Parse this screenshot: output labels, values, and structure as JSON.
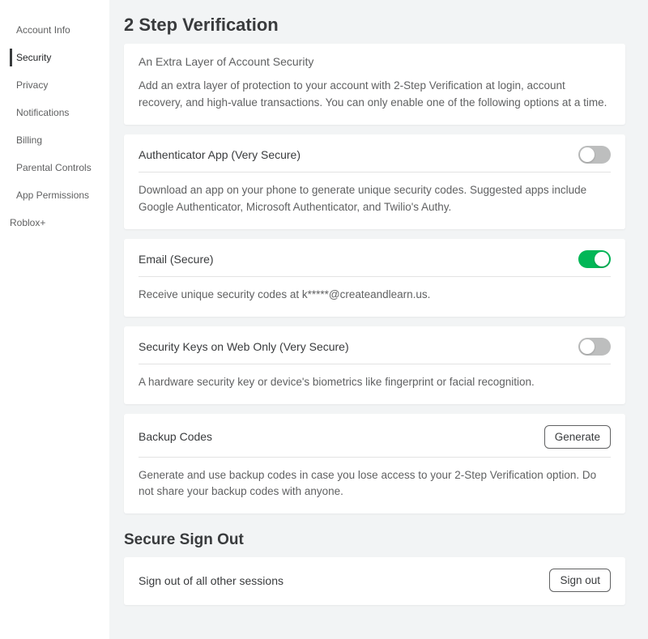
{
  "sidebar": {
    "items": [
      {
        "label": "Account Info",
        "active": false
      },
      {
        "label": "Security",
        "active": true
      },
      {
        "label": "Privacy",
        "active": false
      },
      {
        "label": "Notifications",
        "active": false
      },
      {
        "label": "Billing",
        "active": false
      },
      {
        "label": "Parental Controls",
        "active": false
      },
      {
        "label": "App Permissions",
        "active": false
      }
    ],
    "extra": {
      "label": "Roblox+"
    }
  },
  "twostep": {
    "heading": "2 Step Verification",
    "intro_title": "An Extra Layer of Account Security",
    "intro_desc": "Add an extra layer of protection to your account with 2-Step Verification at login, account recovery, and high-value transactions. You can only enable one of the following options at a time."
  },
  "auth_app": {
    "title": "Authenticator App (Very Secure)",
    "desc": "Download an app on your phone to generate unique security codes. Suggested apps include Google Authenticator, Microsoft Authenticator, and Twilio's Authy.",
    "enabled": false
  },
  "email": {
    "title": "Email (Secure)",
    "desc": "Receive unique security codes at k*****@createandlearn.us.",
    "enabled": true
  },
  "security_keys": {
    "title": "Security Keys on Web Only (Very Secure)",
    "desc": "A hardware security key or device's biometrics like fingerprint or facial recognition.",
    "enabled": false
  },
  "backup": {
    "title": "Backup Codes",
    "button": "Generate",
    "desc": "Generate and use backup codes in case you lose access to your 2-Step Verification option. Do not share your backup codes with anyone."
  },
  "signout": {
    "heading": "Secure Sign Out",
    "title": "Sign out of all other sessions",
    "button": "Sign out"
  }
}
